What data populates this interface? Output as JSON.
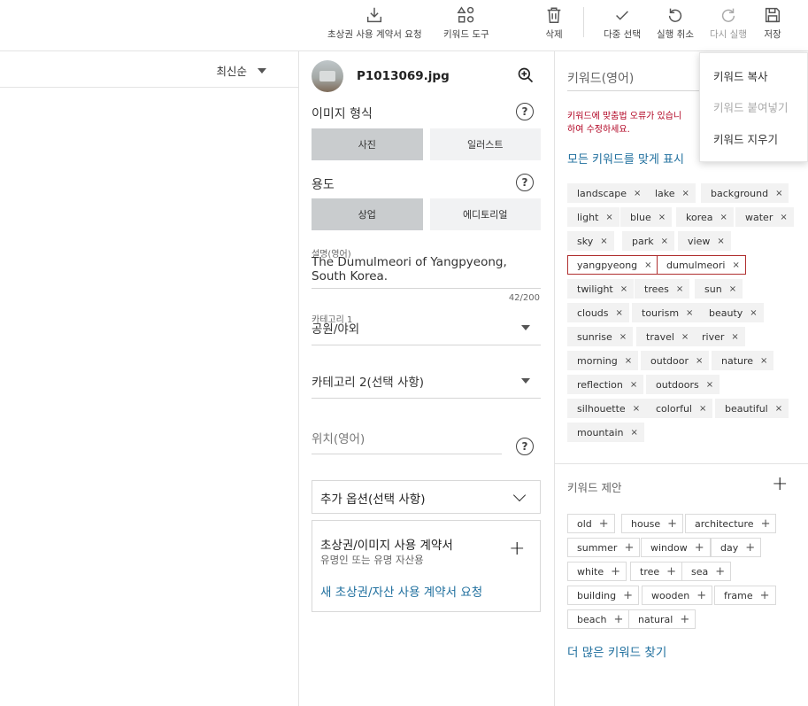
{
  "toolbar": {
    "request_release": "초상권 사용 계약서 요청",
    "keyword_tools": "키워드 도구",
    "delete": "삭제",
    "multi_select": "다중 선택",
    "undo": "실행 취소",
    "redo": "다시 실행",
    "save": "저장"
  },
  "left": {
    "sort_label": "최신순"
  },
  "detail": {
    "filename": "P1013069.jpg",
    "image_type_label": "이미지 형식",
    "image_type_options": [
      "사진",
      "일러스트"
    ],
    "usage_label": "용도",
    "usage_options": [
      "상업",
      "에디토리얼"
    ],
    "description_label": "설명(영어)",
    "description_line1": "The Dumulmeori of Yangpyeong,",
    "description_line2": "South Korea.",
    "description_count": "42/200",
    "category1_label": "카테고리 1",
    "category1_value": "공원/야외",
    "category2_placeholder": "카테고리 2(선택 사항)",
    "location_placeholder": "위치(영어)",
    "extra_options": "추가 옵션(선택 사항)",
    "release_title": "초상권/이미지 사용 계약서",
    "release_sub": "유명인 또는 유명 자산용",
    "release_link": "새 초상권/자산 사용 계약서 요청"
  },
  "keywords": {
    "input_placeholder": "키워드(영어)",
    "error_line1": "키워드에 맞춤법 오류가 있습니",
    "error_line2": "하여 수정하세요.",
    "show_all": "모든 키워드를 맞게 표시",
    "items": [
      "landscape",
      "lake",
      "background",
      "light",
      "blue",
      "korea",
      "water",
      "sky",
      "park",
      "view",
      "yangpyeong",
      "dumulmeori",
      "twilight",
      "trees",
      "sun",
      "clouds",
      "tourism",
      "beauty",
      "sunrise",
      "travel",
      "river",
      "morning",
      "outdoor",
      "nature",
      "reflection",
      "outdoors",
      "silhouette",
      "colorful",
      "beautiful",
      "mountain"
    ],
    "remove_glyph": "×"
  },
  "suggestions": {
    "title": "키워드 제안",
    "items": [
      "old",
      "house",
      "architecture",
      "summer",
      "window",
      "day",
      "white",
      "tree",
      "sea",
      "building",
      "wooden",
      "frame",
      "beach",
      "natural"
    ],
    "add_glyph": "+",
    "more_link": "더 많은 키워드 찾기"
  },
  "context_menu": {
    "copy": "키워드 복사",
    "paste": "키워드 붙여넣기",
    "clear": "키워드 지우기"
  },
  "colors": {
    "link": "#1f6f9e",
    "error": "#b00020",
    "error_chip_border": "#b03030"
  }
}
